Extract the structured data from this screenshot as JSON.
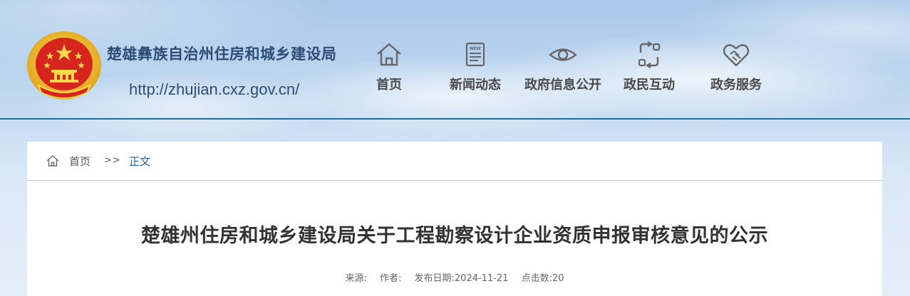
{
  "header": {
    "site_name": "楚雄彝族自治州住房和城乡建设局",
    "site_url": "http://zhujian.cxz.gov.cn/",
    "emblem_icon": "national-emblem-icon"
  },
  "nav": {
    "items": [
      {
        "label": "首页",
        "icon": "home-icon"
      },
      {
        "label": "新闻动态",
        "icon": "newspaper-icon"
      },
      {
        "label": "政府信息公开",
        "icon": "eye-icon"
      },
      {
        "label": "政民互动",
        "icon": "exchange-icon"
      },
      {
        "label": "政务服务",
        "icon": "handshake-heart-icon"
      }
    ]
  },
  "breadcrumb": {
    "home": "首页",
    "separator": ">>",
    "current": "正文"
  },
  "article": {
    "title": "楚雄州住房和城乡建设局关于工程勘察设计企业资质申报审核意见的公示",
    "meta": {
      "source_label": "来源:",
      "author_label": "作者:",
      "date_label": "发布日期:",
      "date": "2024-11-21",
      "clicks_label": "点击数:",
      "clicks": "20"
    }
  },
  "colors": {
    "header_line": "#1f6f9a",
    "site_name": "#2d4d74",
    "breadcrumb_current": "#1d5f9a",
    "emblem_red": "#d7251d",
    "emblem_gold": "#f2c12e"
  }
}
